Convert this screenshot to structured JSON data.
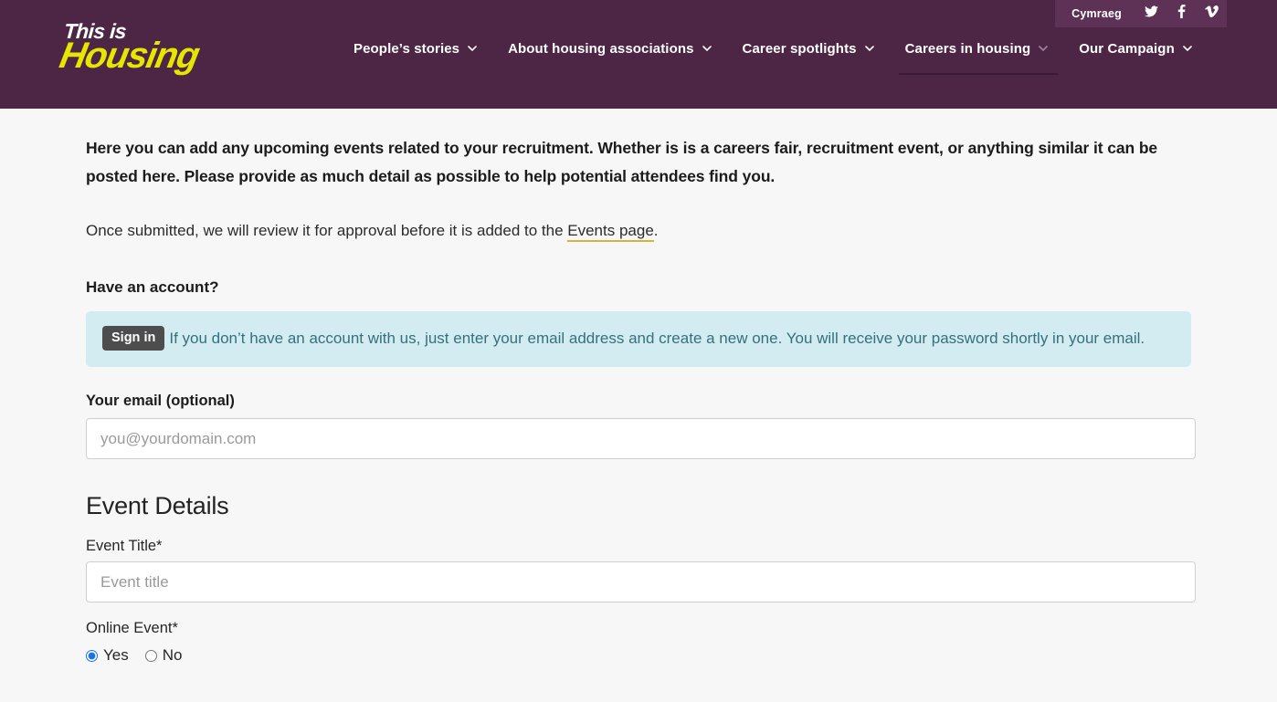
{
  "header": {
    "utility": {
      "language_label": "Cymraeg",
      "social": [
        {
          "name": "twitter-icon",
          "label": "Twitter"
        },
        {
          "name": "facebook-icon",
          "label": "Facebook"
        },
        {
          "name": "vimeo-icon",
          "label": "Vimeo"
        }
      ]
    },
    "logo": {
      "line1": "This is",
      "line2": "Housing"
    },
    "nav": [
      {
        "label": "People’s stories",
        "has_chevron": true,
        "active": false
      },
      {
        "label": "About housing associations",
        "has_chevron": true,
        "active": false
      },
      {
        "label": "Career spotlights",
        "has_chevron": true,
        "active": false
      },
      {
        "label": "Careers in housing",
        "has_chevron": true,
        "active": true
      },
      {
        "label": "Our Campaign",
        "has_chevron": true,
        "active": false
      }
    ]
  },
  "main": {
    "intro_paragraph": "Here you can add any upcoming events related to your recruitment. Whether is is a careers fair, recruitment event, or anything similar it can be posted here. Please provide as much detail as possible to help potential attendees find you.",
    "submit_note_before": "Once submitted, we will review it for approval before it is added to the ",
    "submit_note_link": "Events page",
    "submit_note_after": ".",
    "account_heading": "Have an account?",
    "info_box": {
      "signin_label": "Sign in",
      "message": "If you don’t have an account with us, just enter your email address and create a new one. You will receive your password shortly in your email."
    },
    "email_field": {
      "label": "Your email (optional)",
      "placeholder": "you@yourdomain.com",
      "value": ""
    },
    "event_details_heading": "Event Details",
    "event_title_field": {
      "label": "Event Title*",
      "placeholder": "Event title",
      "value": ""
    },
    "online_event": {
      "label": "Online Event*",
      "options": [
        {
          "label": "Yes",
          "selected": true
        },
        {
          "label": "No",
          "selected": false
        }
      ]
    }
  },
  "colors": {
    "header_purple": "#4d2545",
    "utility_purple": "#5e3157",
    "logo_yellow": "#e6e600",
    "link_underline": "#d7b634",
    "info_box_bg": "#d3ecf1",
    "info_box_text": "#35707d",
    "signin_btn_bg": "#4d4d4d",
    "page_bg": "#f7f7f7",
    "radio_accent": "#1a73e8"
  }
}
